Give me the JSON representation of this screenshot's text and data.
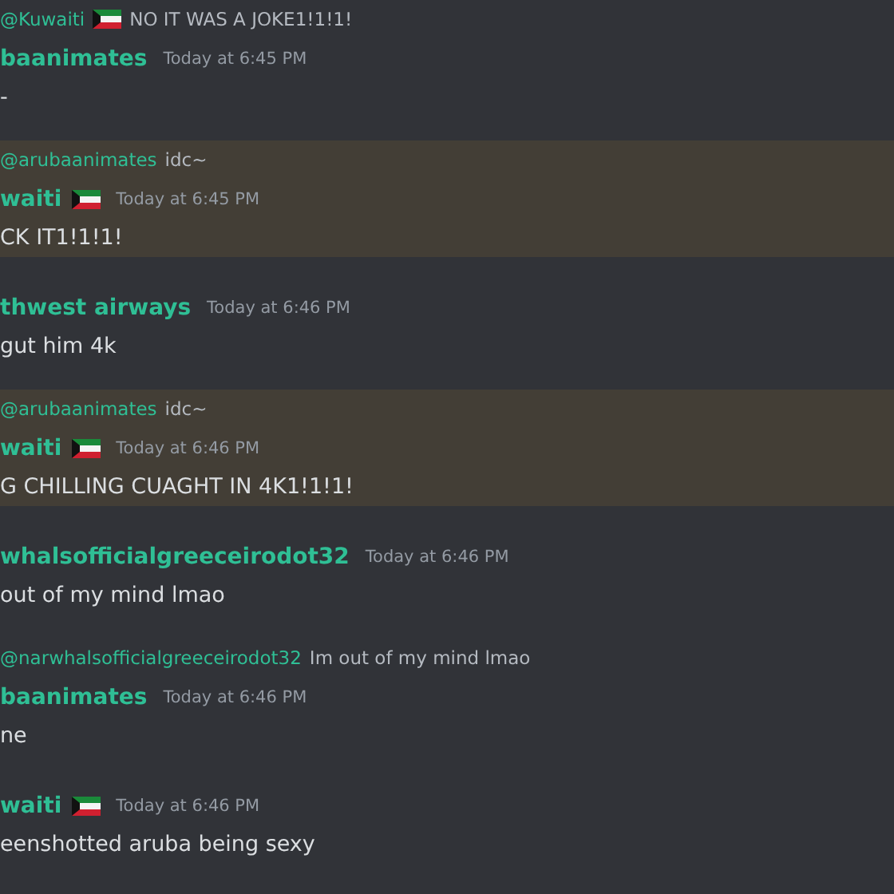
{
  "messages": [
    {
      "highlighted": false,
      "reply": {
        "mention": "@Kuwaiti",
        "mention_flag": true,
        "text": "NO IT WAS A JOKE1!1!1!"
      },
      "author": "baanimates",
      "author_flag": false,
      "time": "Today at 6:45 PM",
      "body": "-"
    },
    {
      "highlighted": true,
      "reply": {
        "mention": "@arubaanimates",
        "mention_flag": false,
        "text": "idc~"
      },
      "author": "waiti",
      "author_flag": true,
      "time": "Today at 6:45 PM",
      "body": "CK IT1!1!1!"
    },
    {
      "highlighted": false,
      "author": "thwest airways",
      "author_flag": false,
      "time": "Today at 6:46 PM",
      "body": "gut him 4k"
    },
    {
      "highlighted": true,
      "reply": {
        "mention": "@arubaanimates",
        "mention_flag": false,
        "text": "idc~"
      },
      "author": "waiti",
      "author_flag": true,
      "time": "Today at 6:46 PM",
      "body": "G CHILLING CUAGHT IN 4K1!1!1!"
    },
    {
      "highlighted": false,
      "author": "whalsofficialgreeceirodot32",
      "author_flag": false,
      "time": "Today at 6:46 PM",
      "body": "out of my mind lmao"
    },
    {
      "highlighted": false,
      "reply": {
        "mention": "@narwhalsofficialgreeceirodot32",
        "mention_flag": false,
        "text": "Im out of my mind lmao"
      },
      "author": "baanimates",
      "author_flag": false,
      "time": "Today at 6:46 PM",
      "body": "ne"
    },
    {
      "highlighted": false,
      "author": "waiti",
      "author_flag": true,
      "time": "Today at 6:46 PM",
      "body": "eenshotted aruba being sexy"
    }
  ]
}
